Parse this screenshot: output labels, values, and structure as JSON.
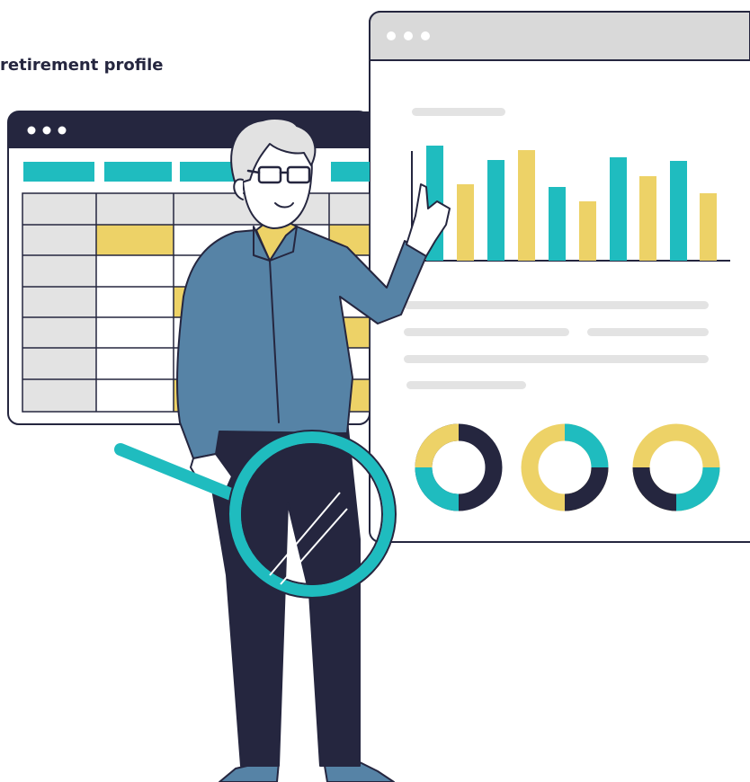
{
  "heading": {
    "text": "retirement profile"
  },
  "colors": {
    "navy": "#25263f",
    "teal": "#1fbcbf",
    "yellow": "#edd267",
    "gray_bar": "#e3e3e3",
    "gray_chrome": "#d9d9d9",
    "shirt_blue": "#5683a6",
    "hair_gray": "#e2e2e2",
    "skin": "#ffffff"
  },
  "icons": {
    "window_controls": "three-dots-icon",
    "magnifier": "magnifying-glass-icon"
  }
}
